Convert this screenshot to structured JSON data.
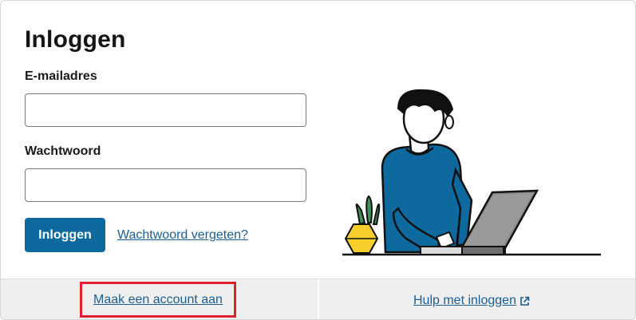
{
  "login": {
    "title": "Inloggen",
    "email_label": "E-mailadres",
    "email_value": "",
    "password_label": "Wachtwoord",
    "password_value": "",
    "submit_label": "Inloggen",
    "forgot_label": "Wachtwoord vergeten?"
  },
  "footer": {
    "create_account_label": "Maak een account aan",
    "help_label": "Hulp met inloggen",
    "help_icon": "external-link-icon"
  },
  "colors": {
    "primary_button": "#0e6a9e",
    "link": "#1c5e92",
    "highlight_border": "#e0202e",
    "footer_bg": "#efefef"
  }
}
